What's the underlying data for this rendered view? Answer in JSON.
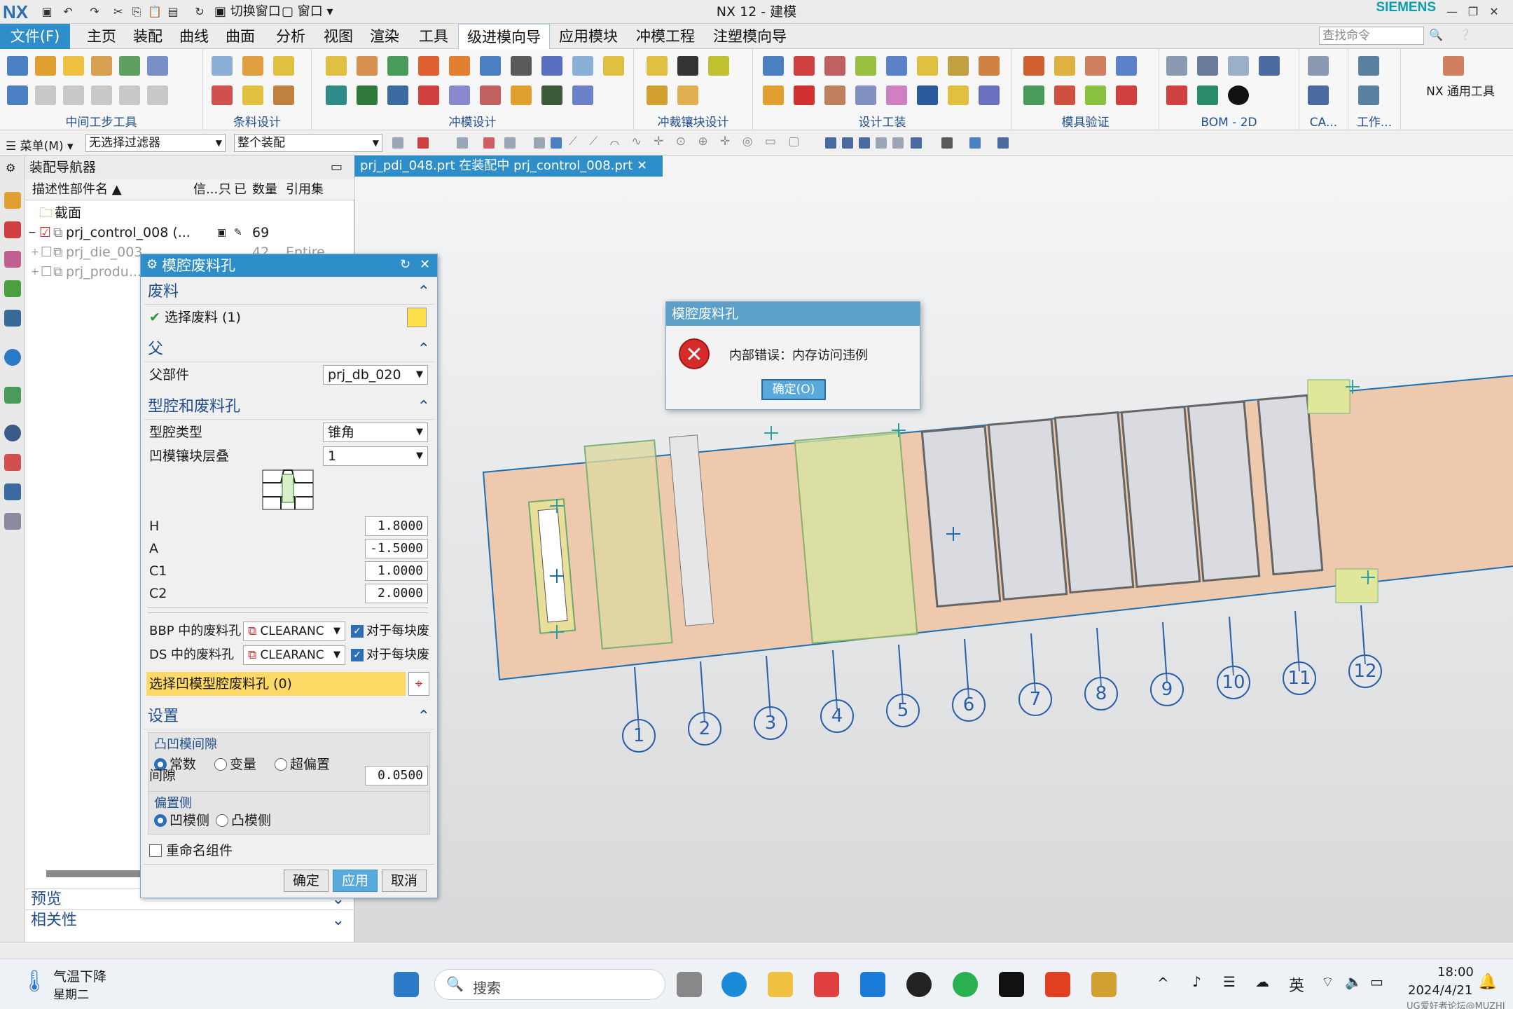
{
  "app": {
    "title": "NX 12 - 建模",
    "brand": "SIEMENS",
    "logo": "NX"
  },
  "quickbar": {
    "switch_window": "切换窗口",
    "window_menu": "窗口"
  },
  "menu": {
    "file": "文件(F)",
    "tabs": [
      "主页",
      "装配",
      "曲线",
      "曲面",
      "分析",
      "视图",
      "渲染",
      "工具",
      "级进模向导",
      "应用模块",
      "冲模工程",
      "注塑模向导"
    ],
    "active_tab": "级进模向导",
    "search_placeholder": "查找命令"
  },
  "ribbon": {
    "groups": [
      "中间工步工具",
      "条料设计",
      "冲模设计",
      "冲裁镶块设计",
      "设计工装",
      "模具验证",
      "BOM - 2D",
      "CA...",
      "工作..."
    ],
    "nx_tools": "NX 通用工具"
  },
  "cmdbar": {
    "menu": "菜单(M)",
    "filter": "无选择过滤器",
    "scope": "整个装配"
  },
  "navigator": {
    "title": "装配导航器",
    "columns": [
      "描述性部件名",
      "信...",
      "只",
      "已",
      "数量",
      "引用集"
    ],
    "rows": [
      {
        "name": "截面",
        "qty": "",
        "ref": ""
      },
      {
        "name": "prj_control_008 (...",
        "qty": "69",
        "ref": ""
      },
      {
        "name": "prj_die_003",
        "qty": "42",
        "ref": "Entire Part"
      },
      {
        "name": "prj_produ...",
        "qty": "",
        "ref": ""
      }
    ],
    "preview": "预览",
    "dependency": "相关性"
  },
  "doc_tab": "prj_pdi_048.prt 在装配中 prj_control_008.prt",
  "dialog": {
    "title": "模腔废料孔",
    "sec_scrap": "废料",
    "select_scrap": "选择废料 (1)",
    "sec_parent": "父",
    "parent_label": "父部件",
    "parent_value": "prj_db_020",
    "sec_cavity": "型腔和废料孔",
    "cavity_type_label": "型腔类型",
    "cavity_type_value": "锥角",
    "die_insert_label": "凹模镶块层叠",
    "die_insert_value": "1",
    "params": [
      {
        "name": "H",
        "value": "1.8000"
      },
      {
        "name": "A",
        "value": "-1.5000"
      },
      {
        "name": "C1",
        "value": "1.0000"
      },
      {
        "name": "C2",
        "value": "2.0000"
      }
    ],
    "bbp_label": "BBP 中的废料孔",
    "bbp_value": "CLEARANC",
    "bbp_check": "对于每块废",
    "ds_label": "DS 中的废料孔",
    "ds_value": "CLEARANC",
    "ds_check": "对于每块废",
    "select_die_cavity": "选择凹模型腔废料孔 (0)",
    "sec_settings": "设置",
    "clearance_group": "凸凹模间隙",
    "radio_const": "常数",
    "radio_var": "变量",
    "radio_over": "超偏置",
    "gap_label": "间隙",
    "gap_value": "0.0500",
    "offset_group": "偏置侧",
    "radio_die": "凹模侧",
    "radio_punch": "凸模侧",
    "rename_label": "重命名组件",
    "ok": "确定",
    "apply": "应用",
    "cancel": "取消"
  },
  "error": {
    "title": "模腔废料孔",
    "message": "内部错误：内存访问违例",
    "ok": "确定(O)"
  },
  "balloons": [
    "1",
    "2",
    "3",
    "4",
    "5",
    "6",
    "7",
    "8",
    "9",
    "10",
    "11",
    "12"
  ],
  "taskbar": {
    "weather": "气温下降",
    "weekday": "星期二",
    "search": "搜索",
    "lang": "英",
    "time": "18:00",
    "date": "2024/4/21",
    "watermark": "UG爱好者论坛@MUZHI"
  },
  "colors": {
    "accent": "#2d8ec9",
    "strip": "#efc9ad",
    "error_red": "#d42b2b",
    "highlight": "#ffd966"
  }
}
